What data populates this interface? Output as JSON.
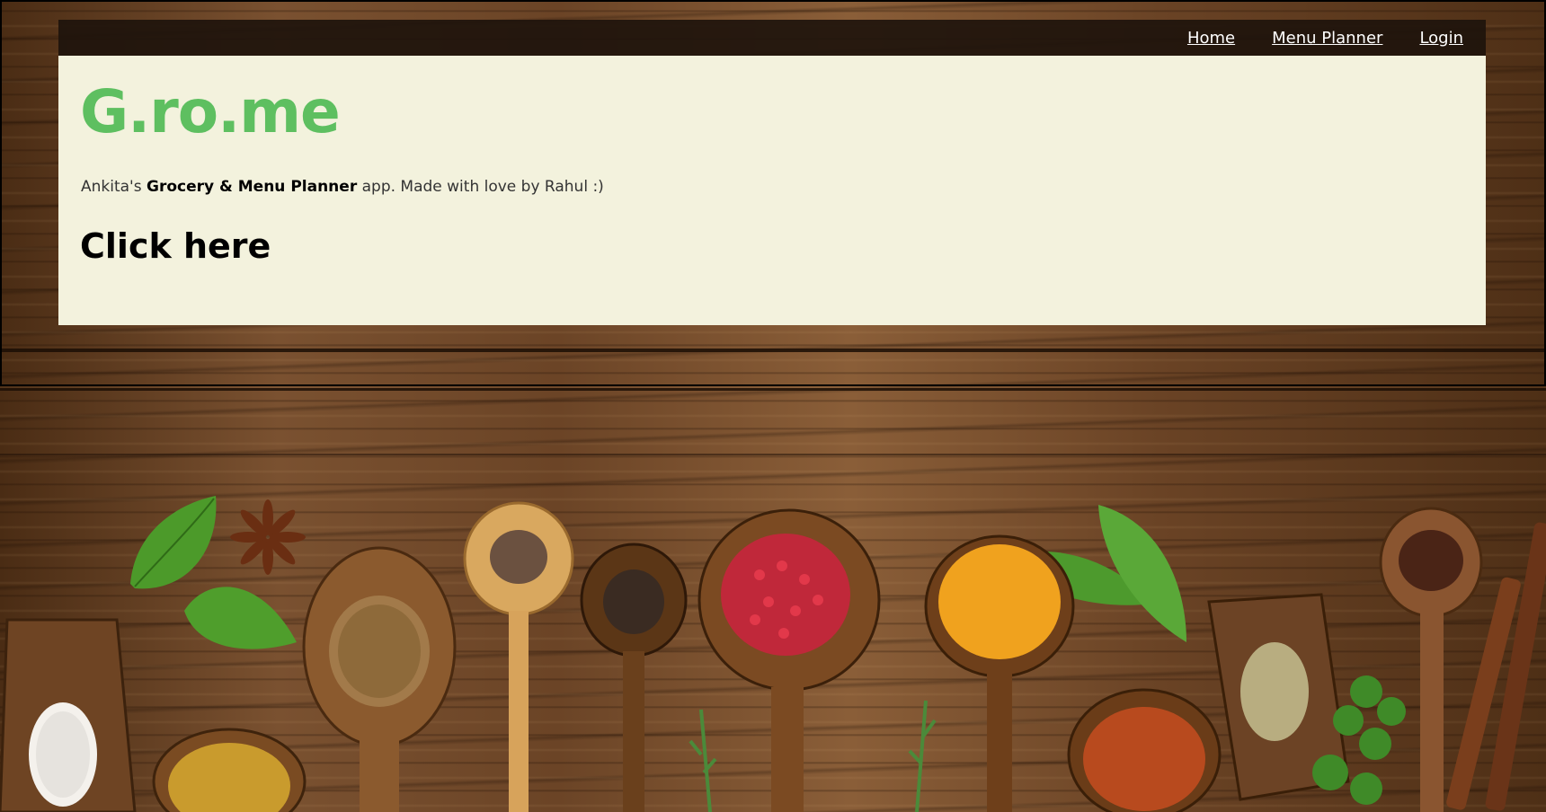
{
  "nav": {
    "links": [
      {
        "label": "Home"
      },
      {
        "label": "Menu Planner"
      },
      {
        "label": "Login"
      }
    ]
  },
  "hero": {
    "brand": "G.ro.me",
    "tagline": {
      "prefix": "Ankita's ",
      "emphasis": "Grocery & Menu Planner",
      "suffix": " app. Made with love by Rahul :)"
    },
    "cta_label": "Click here"
  },
  "colors": {
    "brand": "#5ebf60",
    "panel": "#f3f2dd",
    "navbar": "#1e140c",
    "wood": "#6b4426"
  },
  "decoration": {
    "background_image": "spices-on-wooden-table",
    "items": [
      "sea-salt",
      "basil-leaf",
      "star-anise",
      "cumin-powder",
      "coriander-seeds",
      "peppercorns",
      "black-pepper",
      "pink-peppercorns",
      "turmeric",
      "bay-leaves",
      "chili-flakes",
      "fennel-seeds",
      "cloves",
      "cinnamon-sticks",
      "parsley",
      "rosemary"
    ]
  }
}
